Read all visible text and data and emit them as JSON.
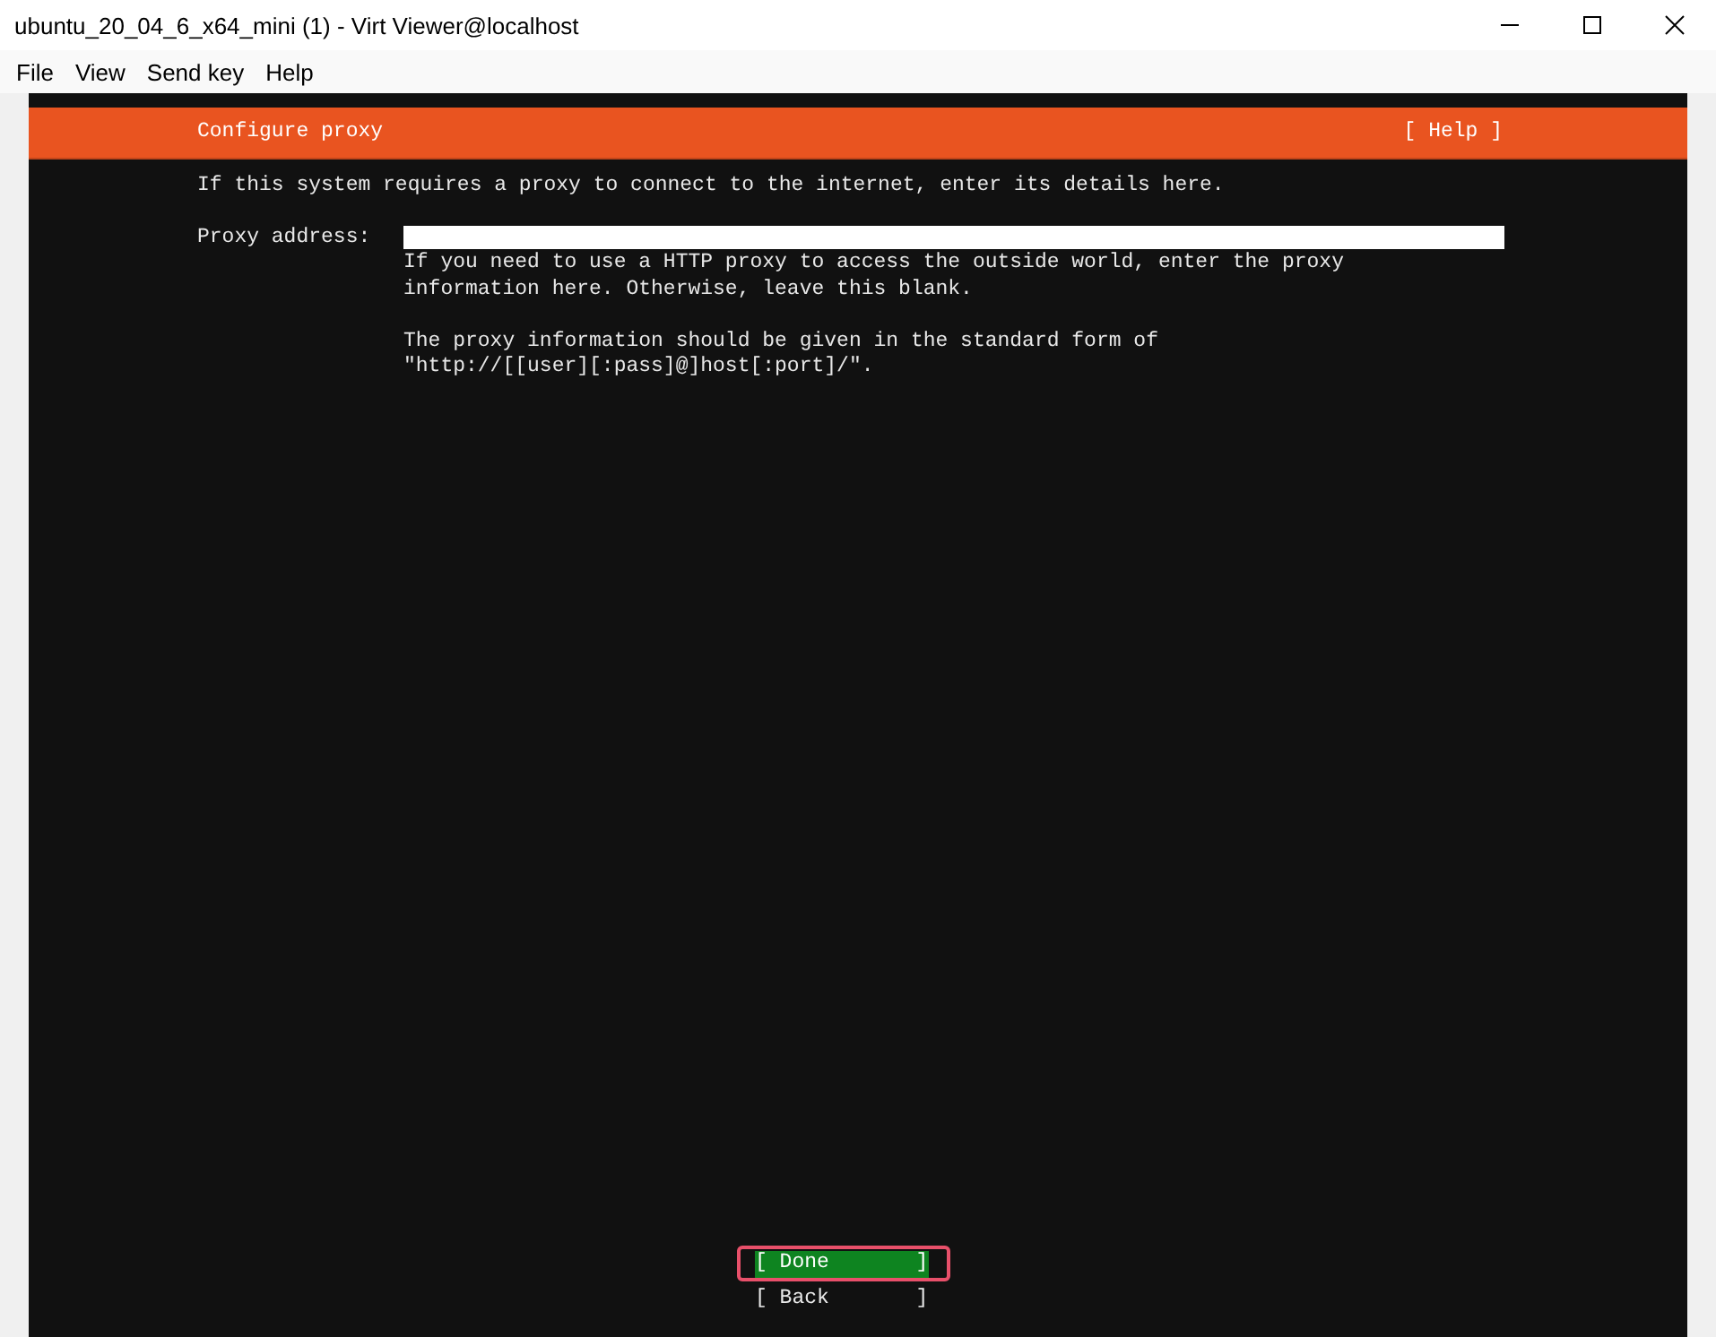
{
  "window": {
    "title": "ubuntu_20_04_6_x64_mini (1) - Virt Viewer@localhost"
  },
  "menu": [
    {
      "label": "File"
    },
    {
      "label": "View"
    },
    {
      "label": "Send key"
    },
    {
      "label": "Help"
    }
  ],
  "screen": {
    "header": {
      "title": "Configure proxy",
      "help": "[ Help ]"
    },
    "intro": "If this system requires a proxy to connect to the internet, enter its details here.",
    "proxy_field": {
      "label": "Proxy address:"
    },
    "help_paragraphs": [
      "If you need to use a HTTP proxy to access the outside world, enter the proxy\ninformation here. Otherwise, leave this blank.",
      "The proxy information should be given in the standard form of\n\"http://[[user][:pass]@]host[:port]/\"."
    ],
    "buttons": [
      {
        "label": "[ Done       ]",
        "selected": true,
        "highlighted": true
      },
      {
        "label": "[ Back       ]",
        "selected": false,
        "highlighted": false
      }
    ]
  }
}
